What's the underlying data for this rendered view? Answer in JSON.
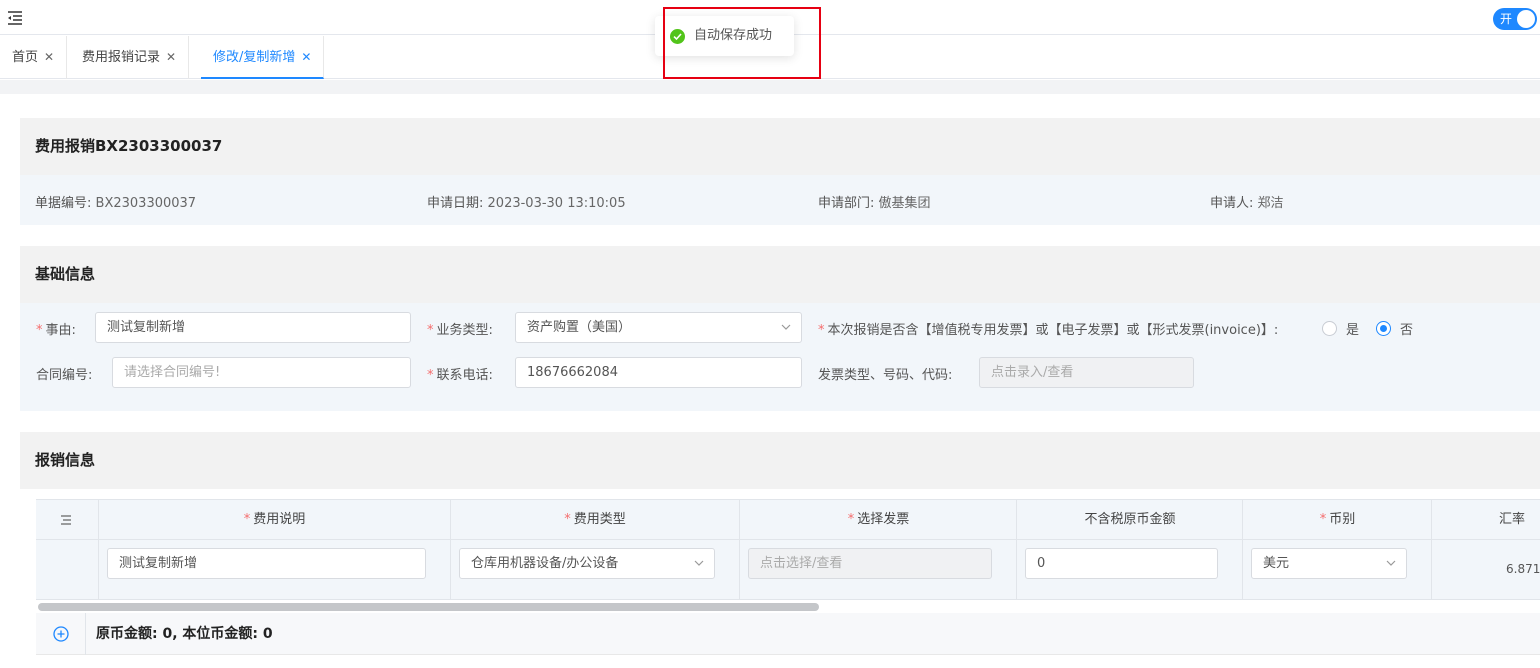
{
  "toast": {
    "message": "自动保存成功"
  },
  "header": {
    "switch_label": "开"
  },
  "tabs": [
    {
      "label": "首页"
    },
    {
      "label": "费用报销记录"
    },
    {
      "label": "修改/复制新增"
    }
  ],
  "summary": {
    "title": "费用报销BX2303300037",
    "doc_no_label": "单据编号:",
    "doc_no": "BX2303300037",
    "date_label": "申请日期:",
    "date": "2023-03-30 13:10:05",
    "dept_label": "申请部门:",
    "dept": "傲基集团",
    "applicant_label": "申请人:",
    "applicant": "郑洁"
  },
  "basic": {
    "title": "基础信息",
    "reason_label": "事由:",
    "reason_value": "测试复制新增",
    "biz_type_label": "业务类型:",
    "biz_type_value": "资产购置（美国）",
    "invoice_question": "本次报销是否含【增值税专用发票】或【电子发票】或【形式发票(invoice)】:",
    "yes_label": "是",
    "no_label": "否",
    "contract_label": "合同编号:",
    "contract_placeholder": "请选择合同编号!",
    "phone_label": "联系电话:",
    "phone_value": "18676662084",
    "invoice_info_label": "发票类型、号码、代码:",
    "invoice_info_placeholder": "点击录入/查看"
  },
  "reimb": {
    "title": "报销信息",
    "columns": {
      "desc": "费用说明",
      "type": "费用类型",
      "invoice": "选择发票",
      "amount": "不含税原币金额",
      "currency": "币别",
      "rate": "汇率"
    },
    "row": {
      "desc": "测试复制新增",
      "type": "仓库用机器设备/办公设备",
      "invoice_placeholder": "点击选择/查看",
      "amount": "0",
      "currency": "美元",
      "rate": "6.871"
    },
    "footer": "原币金额: 0, 本位币金额: 0"
  },
  "colors": {
    "accent": "#1e88ff",
    "required": "#f56c6c",
    "success": "#52c41a",
    "highlight": "#e60012"
  }
}
